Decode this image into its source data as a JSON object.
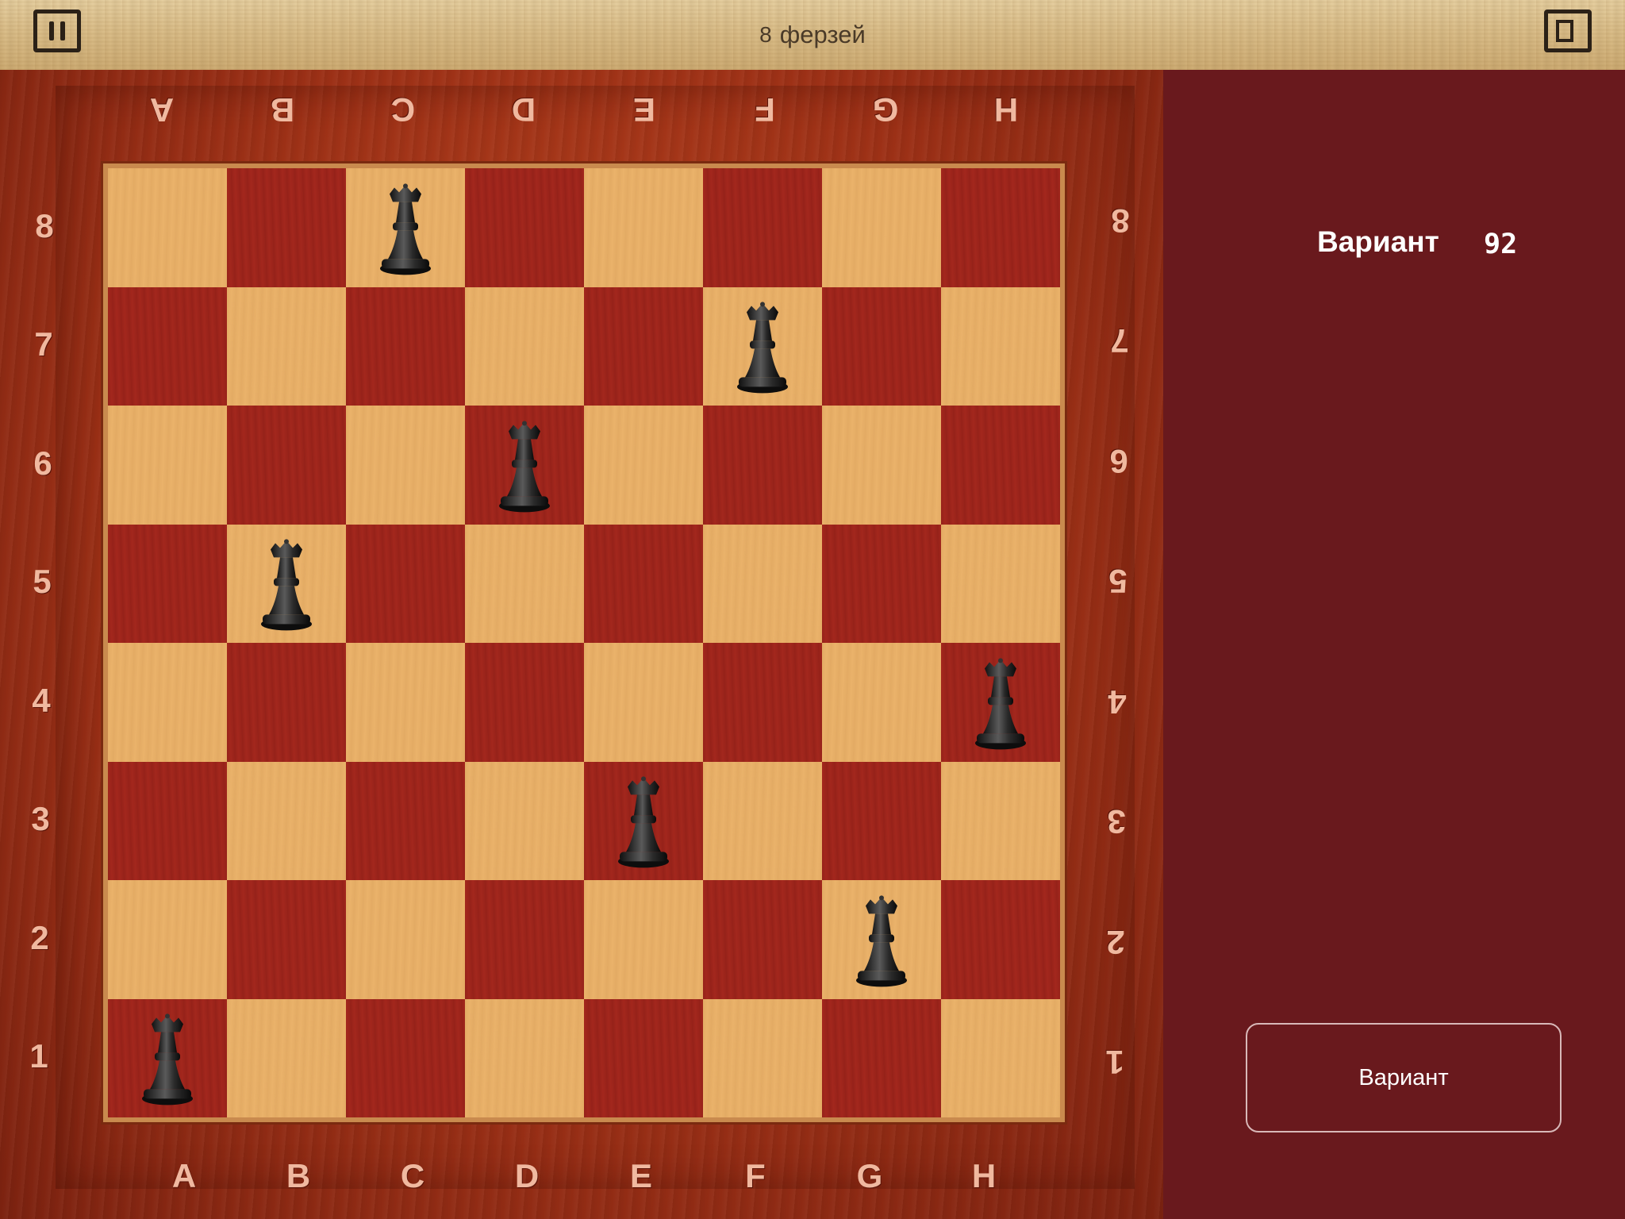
{
  "header": {
    "title": "ферзей",
    "title_icon": "8",
    "pause_icon": "pause-icon",
    "window_icon": "window-icon"
  },
  "board": {
    "files": [
      "A",
      "B",
      "C",
      "D",
      "E",
      "F",
      "G",
      "H"
    ],
    "ranks": [
      "8",
      "7",
      "6",
      "5",
      "4",
      "3",
      "2",
      "1"
    ],
    "queens": [
      "C8",
      "F7",
      "D6",
      "B5",
      "H4",
      "E3",
      "G2",
      "A1"
    ],
    "colors": {
      "light": "#eab26a",
      "dark": "#a3271d",
      "frame": "#9c3016"
    }
  },
  "panel": {
    "variant_label": "Вариант",
    "variant_number": "92",
    "button_label": "Вариант",
    "background": "#69191d"
  }
}
